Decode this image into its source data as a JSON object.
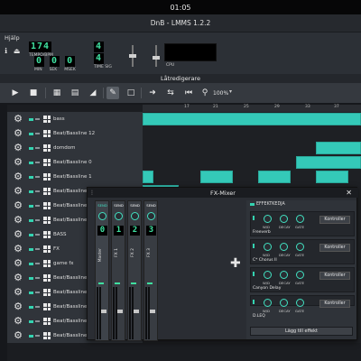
{
  "status_bar": {
    "time": "01:05"
  },
  "window": {
    "title": "DnB - LMMS 1.2.2"
  },
  "menu": {
    "help": "Hjälp"
  },
  "transport": {
    "tempo_value": "174",
    "tempo_label": "TEMPO/BPM",
    "time_min": "0",
    "time_sec": "0",
    "time_msec": "0",
    "min_label": "MIN",
    "sec_label": "SEK",
    "msec_label": "MSEK",
    "timesig_num": "4",
    "timesig_den": "4",
    "timesig_label": "TIME SIG",
    "cpu_label": "CPU"
  },
  "song_editor": {
    "title": "Låtredigerare",
    "zoom": "100%",
    "ruler_ticks": [
      "17",
      "21",
      "25",
      "29",
      "33",
      "37"
    ]
  },
  "tracks": [
    {
      "name": "bass",
      "type": "instrument"
    },
    {
      "name": "Beat/Bassline 12",
      "type": "bb"
    },
    {
      "name": "domdom",
      "type": "instrument"
    },
    {
      "name": "Beat/Bassline 0",
      "type": "bb"
    },
    {
      "name": "Beat/Bassline 1",
      "type": "bb"
    },
    {
      "name": "Beat/Bassline 2",
      "type": "bb"
    },
    {
      "name": "Beat/Bassline 3",
      "type": "bb"
    },
    {
      "name": "Beat/Bassline 4",
      "type": "bb"
    },
    {
      "name": "BASS",
      "type": "instrument"
    },
    {
      "name": "FX",
      "type": "instrument"
    },
    {
      "name": "game fx",
      "type": "instrument"
    },
    {
      "name": "Beat/Bassline 1",
      "type": "bb"
    },
    {
      "name": "Beat/Bassline 1",
      "type": "bb"
    },
    {
      "name": "Beat/Bassline 1",
      "type": "bb"
    },
    {
      "name": "Beat/Bassline 1",
      "type": "bb"
    },
    {
      "name": "Beat/Bassline 1",
      "type": "bb"
    }
  ],
  "fx_mixer": {
    "title": "FX-Mixer",
    "channels": [
      {
        "number": "0",
        "name": "Master",
        "send_label": "SEND"
      },
      {
        "number": "1",
        "name": "FX 1",
        "send_label": "SEND"
      },
      {
        "number": "2",
        "name": "FX 2",
        "send_label": "SEND"
      },
      {
        "number": "3",
        "name": "FX 3",
        "send_label": "SEND"
      }
    ],
    "chain_label": "EFFEKTKEDJA",
    "effects": [
      {
        "name": "Freeverb",
        "knobs": [
          "W/D",
          "DECAY",
          "GATE"
        ],
        "controls_label": "Kontroller"
      },
      {
        "name": "C* Chorus II",
        "knobs": [
          "W/D",
          "DECAY",
          "GATE"
        ],
        "controls_label": "Kontroller"
      },
      {
        "name": "Canyon Delay",
        "knobs": [
          "W/D",
          "DECAY",
          "GATE"
        ],
        "controls_label": "Kontroller"
      },
      {
        "name": "D.LEQ",
        "knobs": [
          "W/D",
          "DECAY",
          "GATE"
        ],
        "controls_label": "Kontroller"
      }
    ],
    "add_effect_label": "Lägg till effekt"
  },
  "colors": {
    "accent": "#34c9b8",
    "lcd": "#3fe0a0"
  }
}
